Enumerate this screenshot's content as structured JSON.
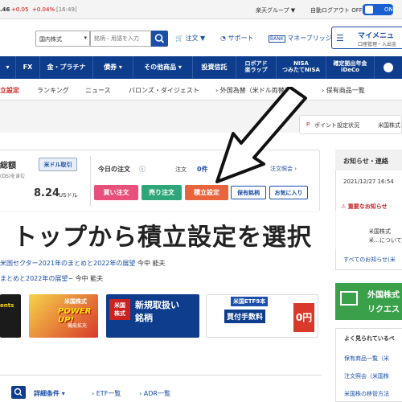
{
  "topbar": {
    "index_value": ".46",
    "change": "+0.05",
    "change_pct": "+0.04%",
    "time": "[16:49]",
    "group_menu": "楽天グループ ▼",
    "auto_logout": "自動ログアウト OFF",
    "toggle_label": "ON"
  },
  "header": {
    "market_select": "国内株式",
    "search_placeholder": "銘柄・用語を入力",
    "order": "注文 ▼",
    "support": "サポート",
    "money_bridge": "マネーブリッジ",
    "mypage": "マイメニュ",
    "mypage_sub": "口座管理・入出金"
  },
  "nav": {
    "items": [
      {
        "label": "FX"
      },
      {
        "label": "金・プラチナ"
      },
      {
        "label": "債券 ▾"
      },
      {
        "label": "その他商品 ▾"
      },
      {
        "label": "投資信託"
      },
      {
        "label": "ロボアド\n楽ラップ"
      },
      {
        "label": "NISA\nつみたてNISA"
      },
      {
        "label": "確定拠出年金\niDeCo"
      }
    ]
  },
  "subnav": {
    "items": [
      {
        "label": "立設定"
      },
      {
        "label": "ランキング"
      },
      {
        "label": "ニュース"
      },
      {
        "label": "バロンズ・ダイジェスト"
      },
      {
        "label": "外国為替（米ドル両替）"
      },
      {
        "label": "保有商品一覧"
      }
    ]
  },
  "points_bar": {
    "label": "ポイント設定状況",
    "market": "米国株式"
  },
  "account": {
    "title": "総額",
    "usd_button": "米ドル取引",
    "note": "(DS)を含む",
    "amount": "8.24",
    "unit": "USドル"
  },
  "orders": {
    "title": "今日の注文",
    "order_label": "注文",
    "order_count": "0件",
    "exec_count": "0件",
    "inquiry_link": "注文照会",
    "buttons": {
      "buy": "買い注文",
      "sell": "売り注文",
      "accumulate": "積立設定",
      "holdings": "保有銘柄",
      "favorites": "お気に入り"
    }
  },
  "overlay_caption": "トップから積立設定を選択",
  "notices": {
    "title": "お知らせ・連絡",
    "date": "2021/12/27 16:54",
    "important": "重要なお知らせ",
    "item1": "米国株式",
    "item2": "米…について",
    "all_link": "すべてのお知らせ(米"
  },
  "articles": [
    {
      "title": "米国セクター2021年のまとめと2022年の展望",
      "author": "今中 能夫"
    },
    {
      "title": "まとめと2022年の展望−",
      "author": "今中 能夫"
    }
  ],
  "banners": {
    "b1": "ents",
    "b2_title": "米国株式",
    "b2_main": "POWER UP!",
    "b2_sub": "機能拡充",
    "b3_tag": "米国\n株式",
    "b3_main": "新規取扱い\n銘柄",
    "b4_title": "米国ETF9本",
    "b4_main": "買付手数料",
    "b4_zero": "0円"
  },
  "right_promo": {
    "title": "外国株式",
    "subtitle": "リクエス"
  },
  "popular": {
    "title": "よく見られているペ",
    "links": [
      {
        "label": "保有商品一覧（米"
      },
      {
        "label": "注文照会（米国株"
      },
      {
        "label": "米国株の移管方法"
      }
    ]
  },
  "filter_bar": {
    "detail": "詳細条件",
    "etf": "ETF一覧",
    "adr": "ADR一覧"
  },
  "colors": {
    "nav_blue": "#0d3d8c",
    "buy_pink": "#e6507a",
    "sell_green": "#2fa67a",
    "accumulate_orange": "#e9633c",
    "link_blue": "#1a4ea8"
  }
}
